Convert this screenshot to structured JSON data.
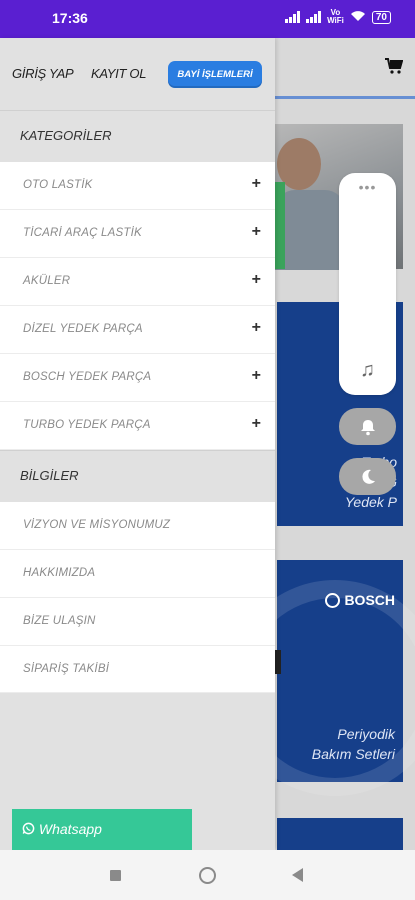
{
  "status_bar": {
    "time": "17:36",
    "volte": "Vo\nWiFi",
    "battery": "70"
  },
  "header": {
    "login": "GİRİŞ YAP",
    "register": "KAYIT OL",
    "dealer": "BAYİ İŞLEMLERİ"
  },
  "categories": {
    "title": "KATEGORİLER",
    "items": [
      {
        "label": "OTO LASTİK",
        "expand": "+"
      },
      {
        "label": "TİCARİ ARAÇ LASTİK",
        "expand": "+"
      },
      {
        "label": "AKÜLER",
        "expand": "+"
      },
      {
        "label": "DİZEL YEDEK PARÇA",
        "expand": "+"
      },
      {
        "label": "BOSCH YEDEK PARÇA",
        "expand": "+"
      },
      {
        "label": "TURBO YEDEK PARÇA",
        "expand": "+"
      }
    ]
  },
  "info": {
    "title": "BİLGİLER",
    "items": [
      {
        "label": "VİZYON VE MİSYONUMUZ"
      },
      {
        "label": "HAKKIMIZDA"
      },
      {
        "label": "BİZE ULAŞIN"
      },
      {
        "label": "SİPARİŞ TAKİBİ"
      }
    ]
  },
  "whatsapp": {
    "label": "Whatsapp"
  },
  "background": {
    "card1_text": "Turbo\nG\nYedek P",
    "card2_brand": "BOSCH",
    "card2_text": "Periyodik\nBakım Setleri"
  }
}
